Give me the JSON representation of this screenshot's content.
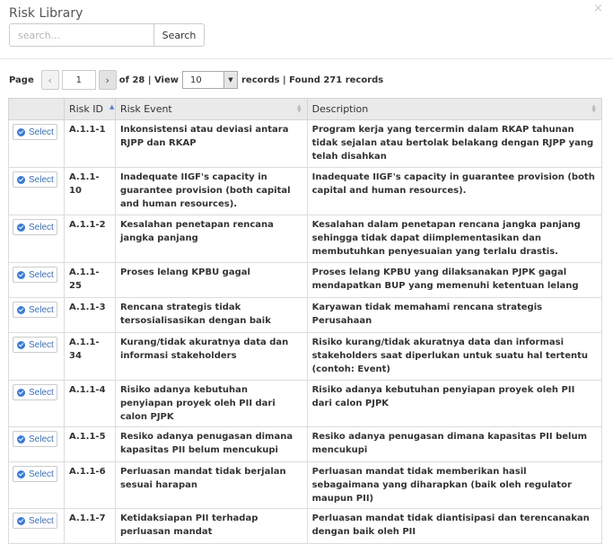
{
  "modal": {
    "title": "Risk Library",
    "close": "×"
  },
  "search": {
    "placeholder": "search...",
    "button_label": "Search"
  },
  "pager": {
    "page_label": "Page",
    "prev": "‹",
    "current_page": "1",
    "next": "›",
    "of_text": "of 28 | View",
    "view_value": "10",
    "records_text": "records | Found 271 records"
  },
  "table": {
    "columns": [
      "",
      "Risk ID",
      "Risk Event",
      "Description"
    ],
    "select_label": "Select",
    "rows": [
      {
        "id": "A.1.1-1",
        "event": "Inkonsistensi atau deviasi antara RJPP dan RKAP",
        "desc": "Program kerja yang tercermin dalam RKAP tahunan tidak sejalan atau bertolak belakang dengan RJPP yang telah disahkan"
      },
      {
        "id": "A.1.1-10",
        "event": "Inadequate IIGF's capacity in guarantee provision (both capital and human resources).",
        "desc": "Inadequate IIGF's capacity in guarantee provision (both capital and human resources)."
      },
      {
        "id": "A.1.1-2",
        "event": "Kesalahan penetapan rencana jangka panjang",
        "desc": "Kesalahan dalam penetapan rencana jangka panjang sehingga tidak dapat diimplementasikan dan membutuhkan penyesuaian yang terlalu drastis."
      },
      {
        "id": "A.1.1-25",
        "event": "Proses lelang KPBU gagal",
        "desc": "Proses lelang KPBU yang dilaksanakan PJPK gagal mendapatkan BUP yang memenuhi ketentuan lelang"
      },
      {
        "id": "A.1.1-3",
        "event": "Rencana strategis tidak tersosialisasikan dengan baik",
        "desc": "Karyawan tidak memahami rencana strategis Perusahaan"
      },
      {
        "id": "A.1.1-34",
        "event": "Kurang/tidak akuratnya data dan informasi stakeholders",
        "desc": "Risiko kurang/tidak akuratnya data dan informasi stakeholders saat diperlukan untuk suatu hal tertentu (contoh: Event)"
      },
      {
        "id": "A.1.1-4",
        "event": "Risiko adanya kebutuhan penyiapan proyek oleh PII dari calon PJPK",
        "desc": "Risiko adanya kebutuhan penyiapan proyek oleh PII dari calon PJPK"
      },
      {
        "id": "A.1.1-5",
        "event": "Resiko adanya penugasan dimana kapasitas PII belum mencukupi",
        "desc": "Resiko adanya penugasan dimana kapasitas PII belum mencukupi"
      },
      {
        "id": "A.1.1-6",
        "event": "Perluasan mandat tidak berjalan sesuai harapan",
        "desc": "Perluasan mandat tidak memberikan hasil sebagaimana yang diharapkan (baik oleh regulator maupun PII)"
      },
      {
        "id": "A.1.1-7",
        "event": "Ketidaksiapan PII terhadap perluasan mandat",
        "desc": "Perluasan mandat tidak diantisipasi dan terencanakan dengan baik oleh PII"
      }
    ]
  }
}
